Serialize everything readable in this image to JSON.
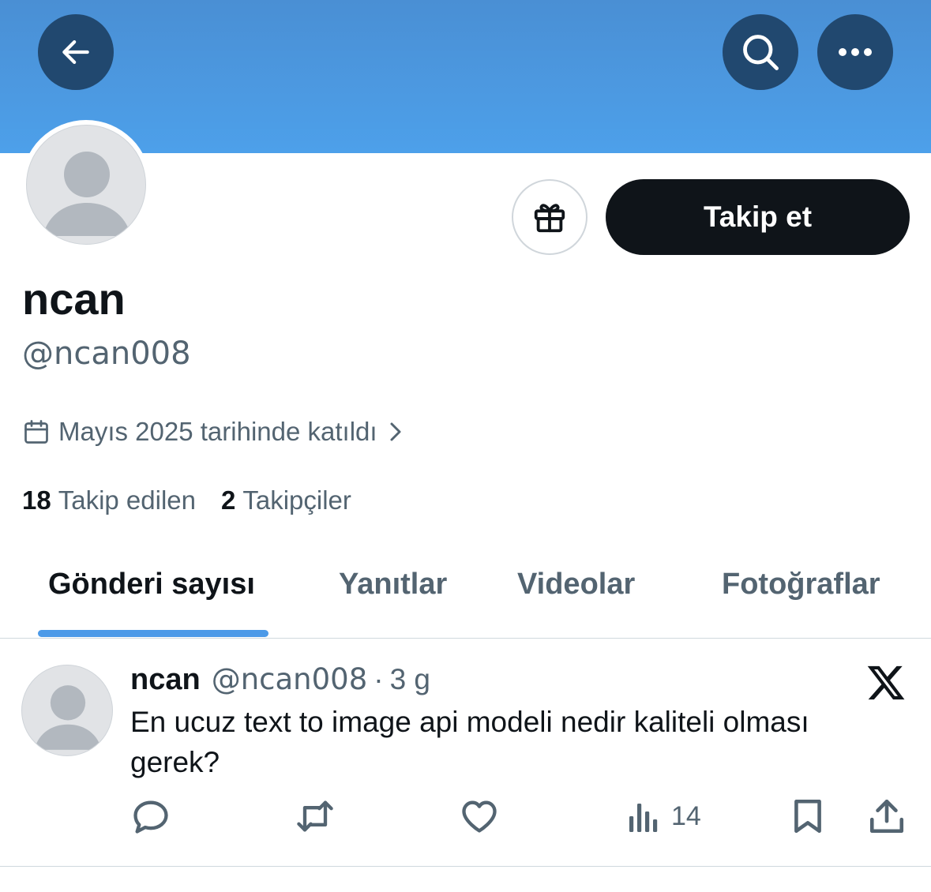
{
  "profile": {
    "display_name": "ncan",
    "handle": "@ncan008",
    "joined": "Mayıs 2025 tarihinde katıldı",
    "following_count": "18",
    "following_label": "Takip edilen",
    "followers_count": "2",
    "followers_label": "Takipçiler"
  },
  "header": {
    "follow_label": "Takip et"
  },
  "tabs": [
    {
      "label": "Gönderi sayısı",
      "active": true
    },
    {
      "label": "Yanıtlar",
      "active": false
    },
    {
      "label": "Videolar",
      "active": false
    },
    {
      "label": "Fotoğraflar",
      "active": false
    }
  ],
  "post": {
    "name": "ncan",
    "handle": "@ncan008",
    "separator": "·",
    "time": "3 g",
    "text": "En ucuz text to image api modeli nedir kaliteli olması gerek?",
    "views": "14"
  },
  "icons": {
    "back": "arrow-left-icon",
    "search": "search-icon",
    "more": "more-horizontal-icon",
    "gift": "gift-icon",
    "calendar": "calendar-icon",
    "chevron": "chevron-right-icon",
    "x_logo": "x-logo-icon",
    "reply": "reply-icon",
    "repost": "repost-icon",
    "like": "heart-icon",
    "views": "views-chart-icon",
    "bookmark": "bookmark-icon",
    "share": "share-icon"
  },
  "colors": {
    "banner": "#4a9ae6",
    "header_button": "#21486f",
    "follow_button": "#0f1419",
    "tab_indicator": "#4c9ae8",
    "secondary_text": "#536471"
  }
}
